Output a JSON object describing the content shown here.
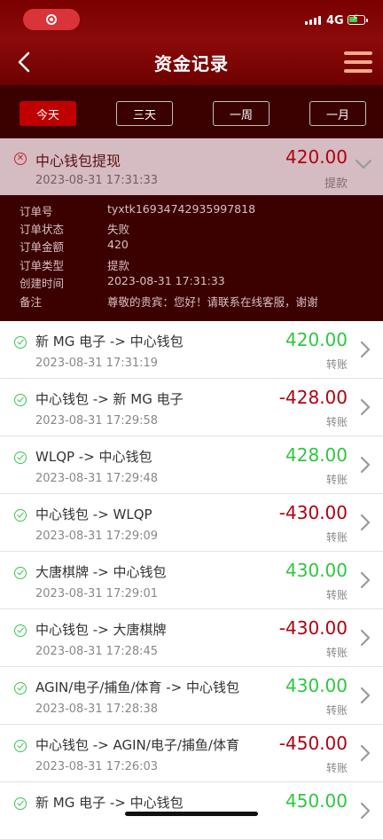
{
  "status_bar": {
    "network": "4G"
  },
  "header": {
    "title": "资金记录"
  },
  "filters": [
    {
      "label": "今天",
      "active": true
    },
    {
      "label": "三天",
      "active": false
    },
    {
      "label": "一周",
      "active": false
    },
    {
      "label": "一月",
      "active": false
    }
  ],
  "expanded_record": {
    "title": "中心钱包提现",
    "time": "2023-08-31 17:31:33",
    "amount": "420.00",
    "type": "提款",
    "details": [
      {
        "key": "订单号",
        "value": "tyxtk16934742935997818"
      },
      {
        "key": "订单状态",
        "value": "失败"
      },
      {
        "key": "订单金额",
        "value": "420"
      },
      {
        "key": "订单类型",
        "value": "提款"
      },
      {
        "key": "创建时间",
        "value": "2023-08-31 17:31:33"
      },
      {
        "key": "备注",
        "value": "尊敬的贵宾：您好！请联系在线客服，谢谢"
      }
    ]
  },
  "transactions": [
    {
      "title": "新 MG 电子 -> 中心钱包",
      "time": "2023-08-31 17:31:19",
      "amount": "420.00",
      "type": "转账",
      "sign": "pos"
    },
    {
      "title": "中心钱包 -> 新 MG 电子",
      "time": "2023-08-31 17:29:58",
      "amount": "-428.00",
      "type": "转账",
      "sign": "neg"
    },
    {
      "title": "WLQP -> 中心钱包",
      "time": "2023-08-31 17:29:48",
      "amount": "428.00",
      "type": "转账",
      "sign": "pos"
    },
    {
      "title": "中心钱包 -> WLQP",
      "time": "2023-08-31 17:29:09",
      "amount": "-430.00",
      "type": "转账",
      "sign": "neg"
    },
    {
      "title": "大唐棋牌 -> 中心钱包",
      "time": "2023-08-31 17:29:01",
      "amount": "430.00",
      "type": "转账",
      "sign": "pos"
    },
    {
      "title": "中心钱包 -> 大唐棋牌",
      "time": "2023-08-31 17:28:45",
      "amount": "-430.00",
      "type": "转账",
      "sign": "neg"
    },
    {
      "title": "AGIN/电子/捕鱼/体育 -> 中心钱包",
      "time": "2023-08-31 17:28:38",
      "amount": "430.00",
      "type": "转账",
      "sign": "pos"
    },
    {
      "title": "中心钱包 -> AGIN/电子/捕鱼/体育",
      "time": "2023-08-31 17:26:03",
      "amount": "-450.00",
      "type": "转账",
      "sign": "neg"
    },
    {
      "title": "新 MG 电子 -> 中心钱包",
      "time": "",
      "amount": "450.00",
      "type": "",
      "sign": "pos"
    }
  ],
  "colors": {
    "header_red": "#8c0a0a",
    "positive": "#2ec73f",
    "negative": "#b00010",
    "active_tab": "#c00000"
  },
  "icons": {
    "back": "chevron-left-icon",
    "menu": "hamburger-menu-icon",
    "failed": "x-circle-icon",
    "success": "check-circle-icon",
    "expand": "chevron-down-icon",
    "row": "chevron-right-icon"
  }
}
